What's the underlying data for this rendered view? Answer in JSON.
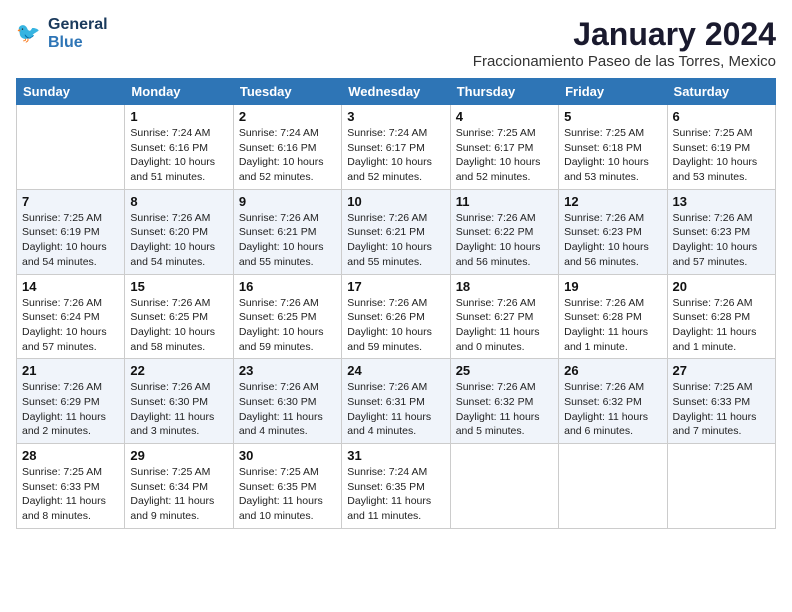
{
  "header": {
    "logo_line1": "General",
    "logo_line2": "Blue",
    "month_year": "January 2024",
    "location": "Fraccionamiento Paseo de las Torres, Mexico"
  },
  "weekdays": [
    "Sunday",
    "Monday",
    "Tuesday",
    "Wednesday",
    "Thursday",
    "Friday",
    "Saturday"
  ],
  "weeks": [
    [
      {
        "day": "",
        "info": ""
      },
      {
        "day": "1",
        "info": "Sunrise: 7:24 AM\nSunset: 6:16 PM\nDaylight: 10 hours\nand 51 minutes."
      },
      {
        "day": "2",
        "info": "Sunrise: 7:24 AM\nSunset: 6:16 PM\nDaylight: 10 hours\nand 52 minutes."
      },
      {
        "day": "3",
        "info": "Sunrise: 7:24 AM\nSunset: 6:17 PM\nDaylight: 10 hours\nand 52 minutes."
      },
      {
        "day": "4",
        "info": "Sunrise: 7:25 AM\nSunset: 6:17 PM\nDaylight: 10 hours\nand 52 minutes."
      },
      {
        "day": "5",
        "info": "Sunrise: 7:25 AM\nSunset: 6:18 PM\nDaylight: 10 hours\nand 53 minutes."
      },
      {
        "day": "6",
        "info": "Sunrise: 7:25 AM\nSunset: 6:19 PM\nDaylight: 10 hours\nand 53 minutes."
      }
    ],
    [
      {
        "day": "7",
        "info": "Sunrise: 7:25 AM\nSunset: 6:19 PM\nDaylight: 10 hours\nand 54 minutes."
      },
      {
        "day": "8",
        "info": "Sunrise: 7:26 AM\nSunset: 6:20 PM\nDaylight: 10 hours\nand 54 minutes."
      },
      {
        "day": "9",
        "info": "Sunrise: 7:26 AM\nSunset: 6:21 PM\nDaylight: 10 hours\nand 55 minutes."
      },
      {
        "day": "10",
        "info": "Sunrise: 7:26 AM\nSunset: 6:21 PM\nDaylight: 10 hours\nand 55 minutes."
      },
      {
        "day": "11",
        "info": "Sunrise: 7:26 AM\nSunset: 6:22 PM\nDaylight: 10 hours\nand 56 minutes."
      },
      {
        "day": "12",
        "info": "Sunrise: 7:26 AM\nSunset: 6:23 PM\nDaylight: 10 hours\nand 56 minutes."
      },
      {
        "day": "13",
        "info": "Sunrise: 7:26 AM\nSunset: 6:23 PM\nDaylight: 10 hours\nand 57 minutes."
      }
    ],
    [
      {
        "day": "14",
        "info": "Sunrise: 7:26 AM\nSunset: 6:24 PM\nDaylight: 10 hours\nand 57 minutes."
      },
      {
        "day": "15",
        "info": "Sunrise: 7:26 AM\nSunset: 6:25 PM\nDaylight: 10 hours\nand 58 minutes."
      },
      {
        "day": "16",
        "info": "Sunrise: 7:26 AM\nSunset: 6:25 PM\nDaylight: 10 hours\nand 59 minutes."
      },
      {
        "day": "17",
        "info": "Sunrise: 7:26 AM\nSunset: 6:26 PM\nDaylight: 10 hours\nand 59 minutes."
      },
      {
        "day": "18",
        "info": "Sunrise: 7:26 AM\nSunset: 6:27 PM\nDaylight: 11 hours\nand 0 minutes."
      },
      {
        "day": "19",
        "info": "Sunrise: 7:26 AM\nSunset: 6:28 PM\nDaylight: 11 hours\nand 1 minute."
      },
      {
        "day": "20",
        "info": "Sunrise: 7:26 AM\nSunset: 6:28 PM\nDaylight: 11 hours\nand 1 minute."
      }
    ],
    [
      {
        "day": "21",
        "info": "Sunrise: 7:26 AM\nSunset: 6:29 PM\nDaylight: 11 hours\nand 2 minutes."
      },
      {
        "day": "22",
        "info": "Sunrise: 7:26 AM\nSunset: 6:30 PM\nDaylight: 11 hours\nand 3 minutes."
      },
      {
        "day": "23",
        "info": "Sunrise: 7:26 AM\nSunset: 6:30 PM\nDaylight: 11 hours\nand 4 minutes."
      },
      {
        "day": "24",
        "info": "Sunrise: 7:26 AM\nSunset: 6:31 PM\nDaylight: 11 hours\nand 4 minutes."
      },
      {
        "day": "25",
        "info": "Sunrise: 7:26 AM\nSunset: 6:32 PM\nDaylight: 11 hours\nand 5 minutes."
      },
      {
        "day": "26",
        "info": "Sunrise: 7:26 AM\nSunset: 6:32 PM\nDaylight: 11 hours\nand 6 minutes."
      },
      {
        "day": "27",
        "info": "Sunrise: 7:25 AM\nSunset: 6:33 PM\nDaylight: 11 hours\nand 7 minutes."
      }
    ],
    [
      {
        "day": "28",
        "info": "Sunrise: 7:25 AM\nSunset: 6:33 PM\nDaylight: 11 hours\nand 8 minutes."
      },
      {
        "day": "29",
        "info": "Sunrise: 7:25 AM\nSunset: 6:34 PM\nDaylight: 11 hours\nand 9 minutes."
      },
      {
        "day": "30",
        "info": "Sunrise: 7:25 AM\nSunset: 6:35 PM\nDaylight: 11 hours\nand 10 minutes."
      },
      {
        "day": "31",
        "info": "Sunrise: 7:24 AM\nSunset: 6:35 PM\nDaylight: 11 hours\nand 11 minutes."
      },
      {
        "day": "",
        "info": ""
      },
      {
        "day": "",
        "info": ""
      },
      {
        "day": "",
        "info": ""
      }
    ]
  ]
}
